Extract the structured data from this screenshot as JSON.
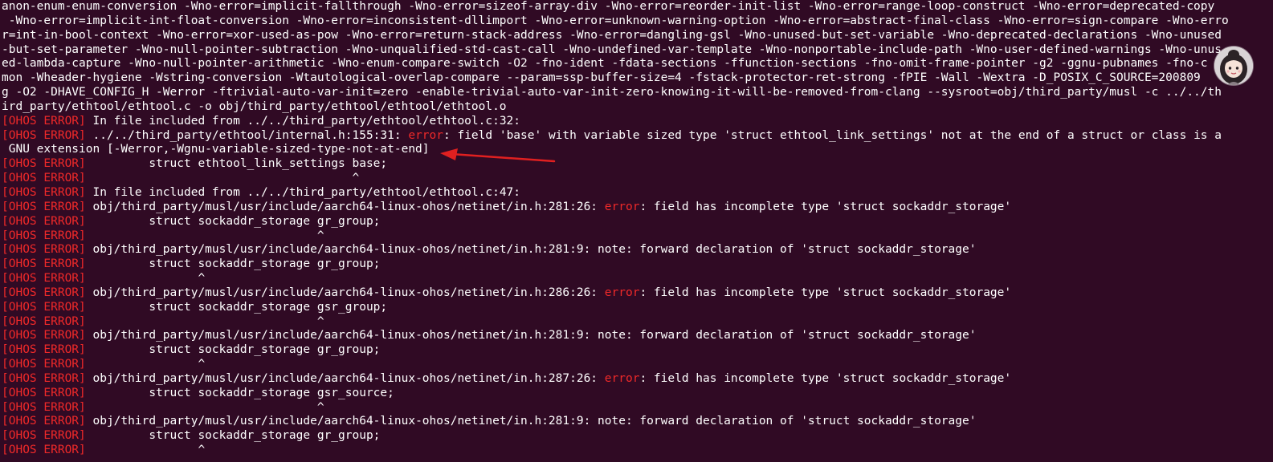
{
  "colors": {
    "background": "#300a24",
    "text": "#ffffff",
    "error_tag": "#ef2929",
    "error_word": "#ef2929",
    "annotation_arrow": "#e02020"
  },
  "terminal": {
    "lines": [
      {
        "parts": [
          {
            "t": "anon-enum-enum-conversion -Wno-error=implicit-fallthrough -Wno-error=sizeof-array-div -Wno-error=reorder-init-list -Wno-error=range-loop-construct -Wno-error=deprecated-copy"
          }
        ]
      },
      {
        "parts": [
          {
            "t": " -Wno-error=implicit-int-float-conversion -Wno-error=inconsistent-dllimport -Wno-error=unknown-warning-option -Wno-error=abstract-final-class -Wno-error=sign-compare -Wno-erro"
          }
        ]
      },
      {
        "parts": [
          {
            "t": "r=int-in-bool-context -Wno-error=xor-used-as-pow -Wno-error=return-stack-address -Wno-error=dangling-gsl -Wno-unused-but-set-variable -Wno-deprecated-declarations -Wno-unused"
          }
        ]
      },
      {
        "parts": [
          {
            "t": "-but-set-parameter -Wno-null-pointer-subtraction -Wno-unqualified-std-cast-call -Wno-undefined-var-template -Wno-nonportable-include-path -Wno-user-defined-warnings -Wno-unus"
          }
        ]
      },
      {
        "parts": [
          {
            "t": "ed-lambda-capture -Wno-null-pointer-arithmetic -Wno-enum-compare-switch -O2 -fno-ident -fdata-sections -ffunction-sections -fno-omit-frame-pointer -g2 -ggnu-pubnames -fno-c"
          }
        ]
      },
      {
        "parts": [
          {
            "t": "mon -Wheader-hygiene -Wstring-conversion -Wtautological-overlap-compare --param=ssp-buffer-size=4 -fstack-protector-ret-strong -fPIE -Wall -Wextra -D_POSIX_C_SOURCE=200809"
          }
        ]
      },
      {
        "parts": [
          {
            "t": "g -O2 -DHAVE_CONFIG_H -Werror -ftrivial-auto-var-init=zero -enable-trivial-auto-var-init-zero-knowing-it-will-be-removed-from-clang --sysroot=obj/third_party/musl -c ../../th"
          }
        ]
      },
      {
        "parts": [
          {
            "t": "ird_party/ethtool/ethtool.c -o obj/third_party/ethtool/ethtool/ethtool.o"
          }
        ]
      },
      {
        "parts": [
          {
            "t": "[OHOS ERROR]",
            "c": "tag"
          },
          {
            "t": " In file included from ../../third_party/ethtool/ethtool.c:32:"
          }
        ]
      },
      {
        "parts": [
          {
            "t": "[OHOS ERROR]",
            "c": "tag"
          },
          {
            "t": " ../../third_party/ethtool/internal.h:155:31: "
          },
          {
            "t": "error",
            "c": "err"
          },
          {
            "t": ": field 'base' with variable sized type 'struct ethtool_link_settings' not at the end of a struct or class is a"
          }
        ]
      },
      {
        "parts": [
          {
            "t": " GNU extension [-Werror,-Wgnu-variable-sized-type-not-at-end]"
          }
        ]
      },
      {
        "parts": [
          {
            "t": "[OHOS ERROR]",
            "c": "tag"
          },
          {
            "t": "         struct ethtool_link_settings base;"
          }
        ]
      },
      {
        "parts": [
          {
            "t": "[OHOS ERROR]",
            "c": "tag"
          },
          {
            "t": "                                      ^"
          }
        ]
      },
      {
        "parts": [
          {
            "t": "[OHOS ERROR]",
            "c": "tag"
          },
          {
            "t": " In file included from ../../third_party/ethtool/ethtool.c:47:"
          }
        ]
      },
      {
        "parts": [
          {
            "t": "[OHOS ERROR]",
            "c": "tag"
          },
          {
            "t": " obj/third_party/musl/usr/include/aarch64-linux-ohos/netinet/in.h:281:26: "
          },
          {
            "t": "error",
            "c": "err"
          },
          {
            "t": ": field has incomplete type 'struct sockaddr_storage'"
          }
        ]
      },
      {
        "parts": [
          {
            "t": "[OHOS ERROR]",
            "c": "tag"
          },
          {
            "t": "         struct sockaddr_storage gr_group;"
          }
        ]
      },
      {
        "parts": [
          {
            "t": "[OHOS ERROR]",
            "c": "tag"
          },
          {
            "t": "                                 ^"
          }
        ]
      },
      {
        "parts": [
          {
            "t": "[OHOS ERROR]",
            "c": "tag"
          },
          {
            "t": " obj/third_party/musl/usr/include/aarch64-linux-ohos/netinet/in.h:281:9: note: forward declaration of 'struct sockaddr_storage'"
          }
        ]
      },
      {
        "parts": [
          {
            "t": "[OHOS ERROR]",
            "c": "tag"
          },
          {
            "t": "         struct sockaddr_storage gr_group;"
          }
        ]
      },
      {
        "parts": [
          {
            "t": "[OHOS ERROR]",
            "c": "tag"
          },
          {
            "t": "                ^"
          }
        ]
      },
      {
        "parts": [
          {
            "t": "[OHOS ERROR]",
            "c": "tag"
          },
          {
            "t": " obj/third_party/musl/usr/include/aarch64-linux-ohos/netinet/in.h:286:26: "
          },
          {
            "t": "error",
            "c": "err"
          },
          {
            "t": ": field has incomplete type 'struct sockaddr_storage'"
          }
        ]
      },
      {
        "parts": [
          {
            "t": "[OHOS ERROR]",
            "c": "tag"
          },
          {
            "t": "         struct sockaddr_storage gsr_group;"
          }
        ]
      },
      {
        "parts": [
          {
            "t": "[OHOS ERROR]",
            "c": "tag"
          },
          {
            "t": "                                 ^"
          }
        ]
      },
      {
        "parts": [
          {
            "t": "[OHOS ERROR]",
            "c": "tag"
          },
          {
            "t": " obj/third_party/musl/usr/include/aarch64-linux-ohos/netinet/in.h:281:9: note: forward declaration of 'struct sockaddr_storage'"
          }
        ]
      },
      {
        "parts": [
          {
            "t": "[OHOS ERROR]",
            "c": "tag"
          },
          {
            "t": "         struct sockaddr_storage gr_group;"
          }
        ]
      },
      {
        "parts": [
          {
            "t": "[OHOS ERROR]",
            "c": "tag"
          },
          {
            "t": "                ^"
          }
        ]
      },
      {
        "parts": [
          {
            "t": "[OHOS ERROR]",
            "c": "tag"
          },
          {
            "t": " obj/third_party/musl/usr/include/aarch64-linux-ohos/netinet/in.h:287:26: "
          },
          {
            "t": "error",
            "c": "err"
          },
          {
            "t": ": field has incomplete type 'struct sockaddr_storage'"
          }
        ]
      },
      {
        "parts": [
          {
            "t": "[OHOS ERROR]",
            "c": "tag"
          },
          {
            "t": "         struct sockaddr_storage gsr_source;"
          }
        ]
      },
      {
        "parts": [
          {
            "t": "[OHOS ERROR]",
            "c": "tag"
          },
          {
            "t": "                                 ^"
          }
        ]
      },
      {
        "parts": [
          {
            "t": "[OHOS ERROR]",
            "c": "tag"
          },
          {
            "t": " obj/third_party/musl/usr/include/aarch64-linux-ohos/netinet/in.h:281:9: note: forward declaration of 'struct sockaddr_storage'"
          }
        ]
      },
      {
        "parts": [
          {
            "t": "[OHOS ERROR]",
            "c": "tag"
          },
          {
            "t": "         struct sockaddr_storage gr_group;"
          }
        ]
      },
      {
        "parts": [
          {
            "t": "[OHOS ERROR]",
            "c": "tag"
          },
          {
            "t": "                ^"
          }
        ]
      }
    ]
  },
  "overlay": {
    "avatar_icon": "cartoon-girl-avatar-icon",
    "arrow_icon": "red-annotation-arrow-icon"
  }
}
